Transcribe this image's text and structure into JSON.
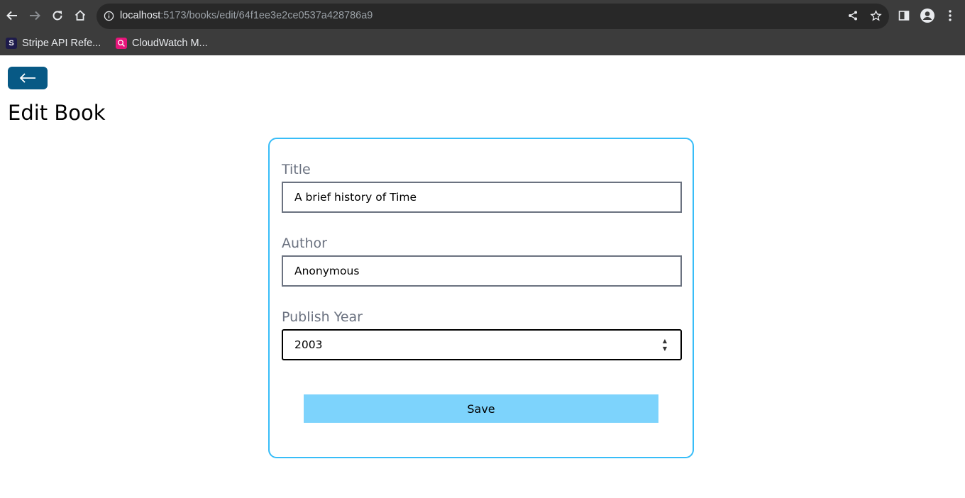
{
  "browser": {
    "url_host": "localhost",
    "url_rest": ":5173/books/edit/64f1ee3e2ce0537a428786a9",
    "bookmarks": [
      {
        "label": "Stripe API Refe...",
        "icon": "stripe-icon",
        "icon_text": "S",
        "color": "#1e1b4b"
      },
      {
        "label": "CloudWatch M...",
        "icon": "cloudwatch-icon",
        "icon_text": "",
        "color": "#e7157b"
      }
    ]
  },
  "page": {
    "back_icon": "arrow-left-icon",
    "title": "Edit Book"
  },
  "form": {
    "fields": [
      {
        "label": "Title",
        "value": "A brief history of Time"
      },
      {
        "label": "Author",
        "value": "Anonymous"
      },
      {
        "label": "Publish Year",
        "value": "2003"
      }
    ],
    "save_label": "Save"
  },
  "colors": {
    "chrome_bg": "#3c3c3c",
    "back_button": "#075985",
    "card_border": "#38bdf8",
    "save_button": "#7dd3fc"
  }
}
